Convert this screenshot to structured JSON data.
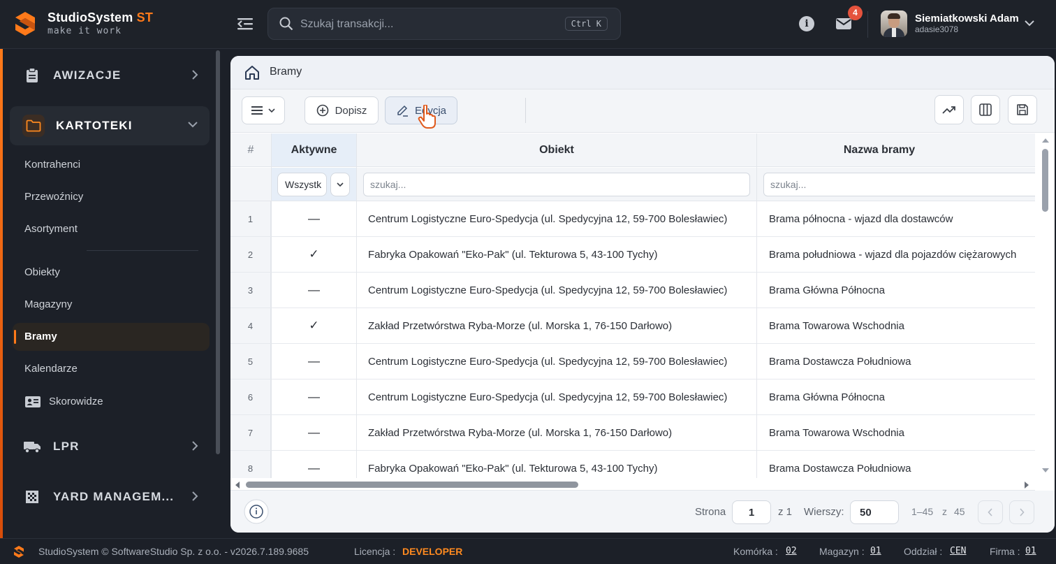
{
  "app": {
    "name": "StudioSystem",
    "name_suffix": "ST",
    "tagline": "make it work",
    "accent": "#ff7a1a"
  },
  "search": {
    "placeholder": "Szukaj transakcji...",
    "shortcut": "Ctrl K"
  },
  "header": {
    "notifications_count": "4",
    "user_name": "Siemiatkowski Adam",
    "user_login": "adasie3078"
  },
  "sidebar": {
    "sections": [
      {
        "label": "AWIZACJE",
        "icon": "clipboard-icon"
      },
      {
        "label": "KARTOTEKI",
        "icon": "folder-icon"
      },
      {
        "label": "LPR",
        "icon": "truck-icon"
      },
      {
        "label": "YARD MANAGEM...",
        "icon": "grid-pattern-icon"
      }
    ],
    "items": [
      {
        "label": "Kontrahenci"
      },
      {
        "label": "Przewoźnicy"
      },
      {
        "label": "Asortyment"
      },
      {
        "label": "Obiekty"
      },
      {
        "label": "Magazyny"
      },
      {
        "label": "Bramy"
      },
      {
        "label": "Kalendarze"
      },
      {
        "label": "Skorowidze"
      }
    ]
  },
  "page": {
    "title": "Bramy"
  },
  "toolbar": {
    "add_label": "Dopisz",
    "edit_label": "Edycja"
  },
  "table": {
    "columns": [
      "#",
      "Aktywne",
      "Obiekt",
      "Nazwa bramy"
    ],
    "filters": {
      "active_select": "Wszystk",
      "object_placeholder": "szukaj...",
      "gate_placeholder": "szukaj..."
    },
    "rows": [
      {
        "n": "1",
        "active": "—",
        "object": "Centrum Logistyczne Euro-Spedycja (ul. Spedycyjna 12, 59-700 Bolesławiec)",
        "gate": "Brama północna - wjazd dla dostawców"
      },
      {
        "n": "2",
        "active": "✓",
        "object": "Fabryka Opakowań \"Eko-Pak\" (ul. Tekturowa 5, 43-100 Tychy)",
        "gate": "Brama południowa - wjazd dla pojazdów ciężarowych"
      },
      {
        "n": "3",
        "active": "—",
        "object": "Centrum Logistyczne Euro-Spedycja (ul. Spedycyjna 12, 59-700 Bolesławiec)",
        "gate": "Brama Główna Północna"
      },
      {
        "n": "4",
        "active": "✓",
        "object": "Zakład Przetwórstwa Ryba-Morze (ul. Morska 1, 76-150 Darłowo)",
        "gate": "Brama Towarowa Wschodnia"
      },
      {
        "n": "5",
        "active": "—",
        "object": "Centrum Logistyczne Euro-Spedycja (ul. Spedycyjna 12, 59-700 Bolesławiec)",
        "gate": "Brama Dostawcza Południowa"
      },
      {
        "n": "6",
        "active": "—",
        "object": "Centrum Logistyczne Euro-Spedycja (ul. Spedycyjna 12, 59-700 Bolesławiec)",
        "gate": "Brama Główna Północna"
      },
      {
        "n": "7",
        "active": "—",
        "object": "Zakład Przetwórstwa Ryba-Morze (ul. Morska 1, 76-150 Darłowo)",
        "gate": "Brama Towarowa Wschodnia"
      },
      {
        "n": "8",
        "active": "—",
        "object": "Fabryka Opakowań \"Eko-Pak\" (ul. Tekturowa 5, 43-100 Tychy)",
        "gate": "Brama Dostawcza Południowa"
      }
    ]
  },
  "pagination": {
    "page_label": "Strona",
    "page": "1",
    "of_label": "z 1",
    "rows_label": "Wierszy:",
    "rows_per_page": "50",
    "range": "1–45",
    "range_of": "z",
    "total": "45"
  },
  "statusbar": {
    "copyright": "StudioSystem © SoftwareStudio Sp. z o.o. - v2026.7.189.9685",
    "license_label": "Licencja :",
    "license_value": "DEVELOPER",
    "cell_label": "Komórka :",
    "cell_value": "02",
    "warehouse_label": "Magazyn :",
    "warehouse_value": "01",
    "branch_label": "Oddział :",
    "branch_value": "CEN",
    "company_label": "Firma :",
    "company_value": "01"
  }
}
